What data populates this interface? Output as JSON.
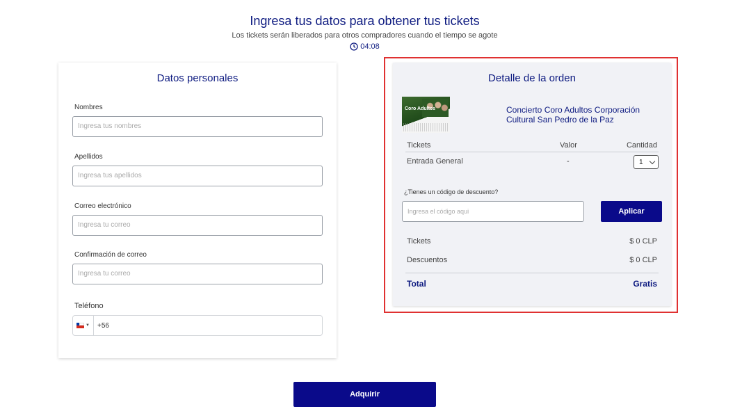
{
  "header": {
    "title": "Ingresa tus datos para obtener tus tickets",
    "subtitle": "Los tickets serán liberados para otros compradores cuando el tiempo se agote",
    "timer": "04:08"
  },
  "personal": {
    "title": "Datos personales",
    "fields": [
      {
        "label": "Nombres",
        "placeholder": "Ingresa tus nombres"
      },
      {
        "label": "Apellidos",
        "placeholder": "Ingresa tus apellidos"
      },
      {
        "label": "Correo electrónico",
        "placeholder": "Ingresa tu correo"
      },
      {
        "label": "Confirmación de correo",
        "placeholder": "Ingresa tu correo"
      }
    ],
    "phone": {
      "label": "Teléfono",
      "code": "+56"
    }
  },
  "order": {
    "title": "Detalle de la orden",
    "thumb_text": "Coro Adultos",
    "event_name": "Concierto Coro Adultos Corporación Cultural San Pedro de la Paz",
    "table": {
      "headers": [
        "Tickets",
        "Valor",
        "Cantidad"
      ],
      "rows": [
        {
          "ticket": "Entrada General",
          "value": "-",
          "quantity": "1"
        }
      ]
    },
    "discount": {
      "label": "¿Tienes un código de descuento?",
      "placeholder": "Ingresa el código aqui",
      "button": "Aplicar"
    },
    "summary": {
      "tickets_label": "Tickets",
      "tickets_value": "$ 0 CLP",
      "discounts_label": "Descuentos",
      "discounts_value": "$ 0 CLP",
      "total_label": "Total",
      "total_value": "Gratis"
    }
  },
  "actions": {
    "buy": "Adquirir"
  },
  "colors": {
    "accent": "#0d1a80",
    "button": "#0a0a8a",
    "highlight": "#e03131"
  }
}
